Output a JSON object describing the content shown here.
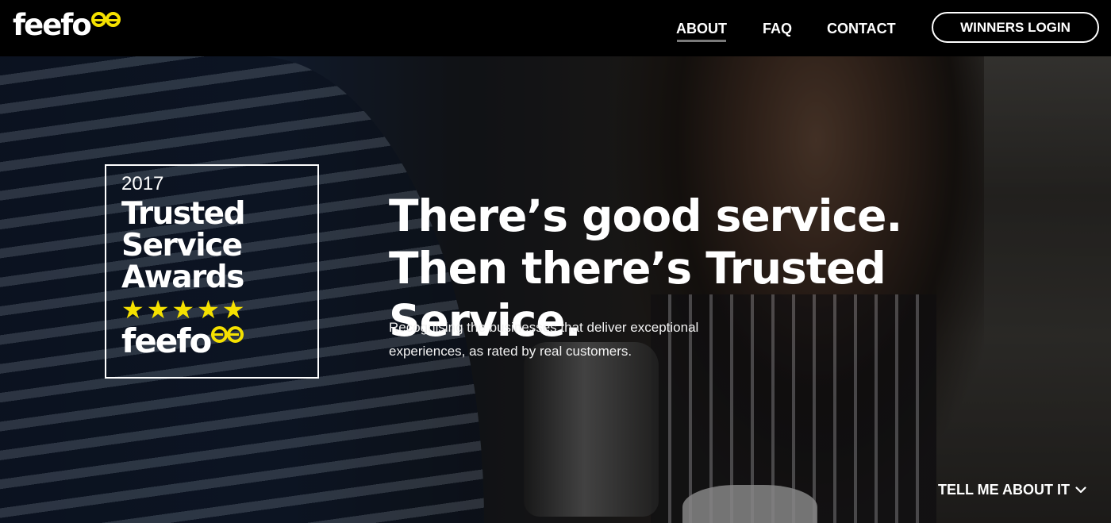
{
  "brand": {
    "logo_text": "feefo",
    "accent_color": "#f5e100"
  },
  "nav": {
    "items": [
      {
        "label": "ABOUT",
        "active": true
      },
      {
        "label": "FAQ"
      },
      {
        "label": "CONTACT"
      }
    ],
    "login_label": "WINNERS LOGIN"
  },
  "award": {
    "year": "2017",
    "title_lines": [
      "Trusted",
      "Service",
      "Awards"
    ],
    "star_count": 5,
    "logo_text": "feefo"
  },
  "hero": {
    "headline_line1": "There’s good service.",
    "headline_line2": "Then there’s Trusted Service.",
    "subtext_line1": "Recognising the businesses that deliver exceptional",
    "subtext_line2": "experiences, as rated by real customers.",
    "cta_label": "TELL ME ABOUT IT",
    "cta_icon": "chevron-down-icon"
  }
}
